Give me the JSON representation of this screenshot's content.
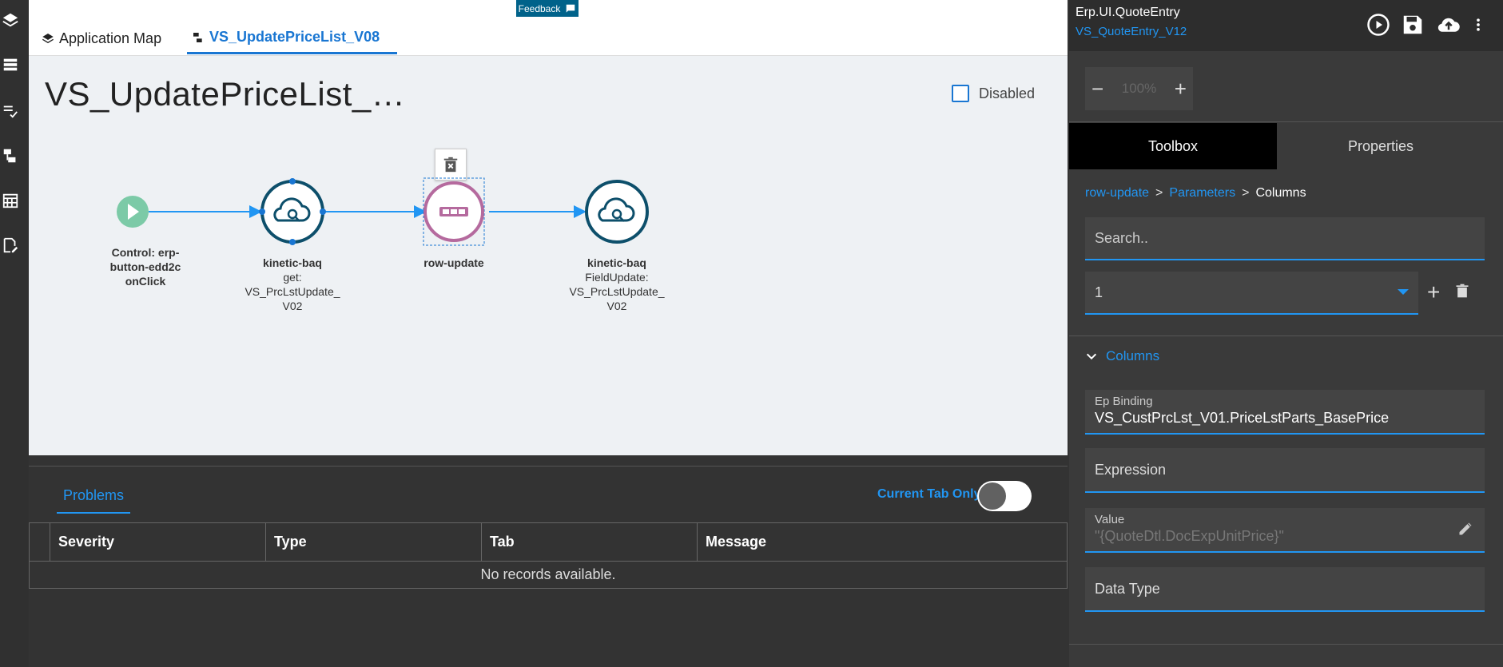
{
  "tabs": {
    "app_map": "Application Map",
    "workflow": "VS_UpdatePriceList_V08"
  },
  "feedback": "Feedback",
  "canvas": {
    "title": "VS_UpdatePriceList_…",
    "disabled_label": "Disabled",
    "nodes": [
      {
        "line1": "Control: erp-",
        "line2": "button-edd2c",
        "line3": "onClick"
      },
      {
        "line1": "kinetic-baq",
        "line2": "get:",
        "line3": "VS_PrcLstUpdate_",
        "line4": "V02"
      },
      {
        "line1": "row-update"
      },
      {
        "line1": "kinetic-baq",
        "line2": "FieldUpdate:",
        "line3": "VS_PrcLstUpdate_",
        "line4": "V02"
      }
    ]
  },
  "problems": {
    "tab_label": "Problems",
    "current_tab_only": "Current Tab Only",
    "toggle_on": false,
    "columns": [
      "Severity",
      "Type",
      "Tab",
      "Message"
    ],
    "empty_message": "No records available."
  },
  "right_panel": {
    "app_name": "Erp.UI.QuoteEntry",
    "page_name": "VS_QuoteEntry_V12",
    "zoom": "100%",
    "tabs": [
      "Toolbox",
      "Properties"
    ],
    "breadcrumb": [
      "row-update",
      "Parameters",
      "Columns"
    ],
    "search_placeholder": "Search..",
    "selected_column": "1",
    "section_title": "Columns",
    "ep_binding_label": "Ep Binding",
    "ep_binding_value": "VS_CustPrcLst_V01.PriceLstParts_BasePrice",
    "expression_label": "Expression",
    "value_label": "Value",
    "value_value": "\"{QuoteDtl.DocExpUnitPrice}\"",
    "data_type_label": "Data Type"
  },
  "colors": {
    "accent": "#2196f3",
    "node_dark": "#0d4f6b",
    "node_start": "#7ccaa7",
    "node_selected": "#b56a9e"
  }
}
